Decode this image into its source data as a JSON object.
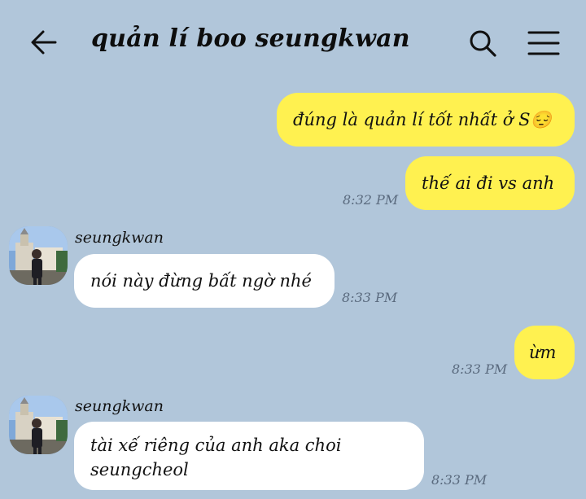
{
  "header": {
    "title": "quản lí boo seungkwan",
    "back_icon": "arrow-left-icon",
    "search_icon": "search-icon",
    "menu_icon": "hamburger-menu-icon"
  },
  "colors": {
    "background": "#b1c6da",
    "sent_bubble": "#fff150",
    "received_bubble": "#ffffff",
    "timestamp": "#5a6a7e"
  },
  "messages": [
    {
      "direction": "sent",
      "text": "đúng là quản lí tốt nhất ở S😔",
      "time": ""
    },
    {
      "direction": "sent",
      "text": "thế ai đi vs anh",
      "time": "8:32 PM"
    },
    {
      "direction": "received",
      "sender": "seungkwan",
      "text": "nói này đừng bất ngờ nhé",
      "time": "8:33 PM"
    },
    {
      "direction": "sent",
      "text": "ừm",
      "time": "8:33 PM"
    },
    {
      "direction": "received",
      "sender": "seungkwan",
      "text_line1": "tài xế riêng của anh aka choi",
      "text_line2": "seungcheol",
      "time": "8:33 PM"
    }
  ]
}
